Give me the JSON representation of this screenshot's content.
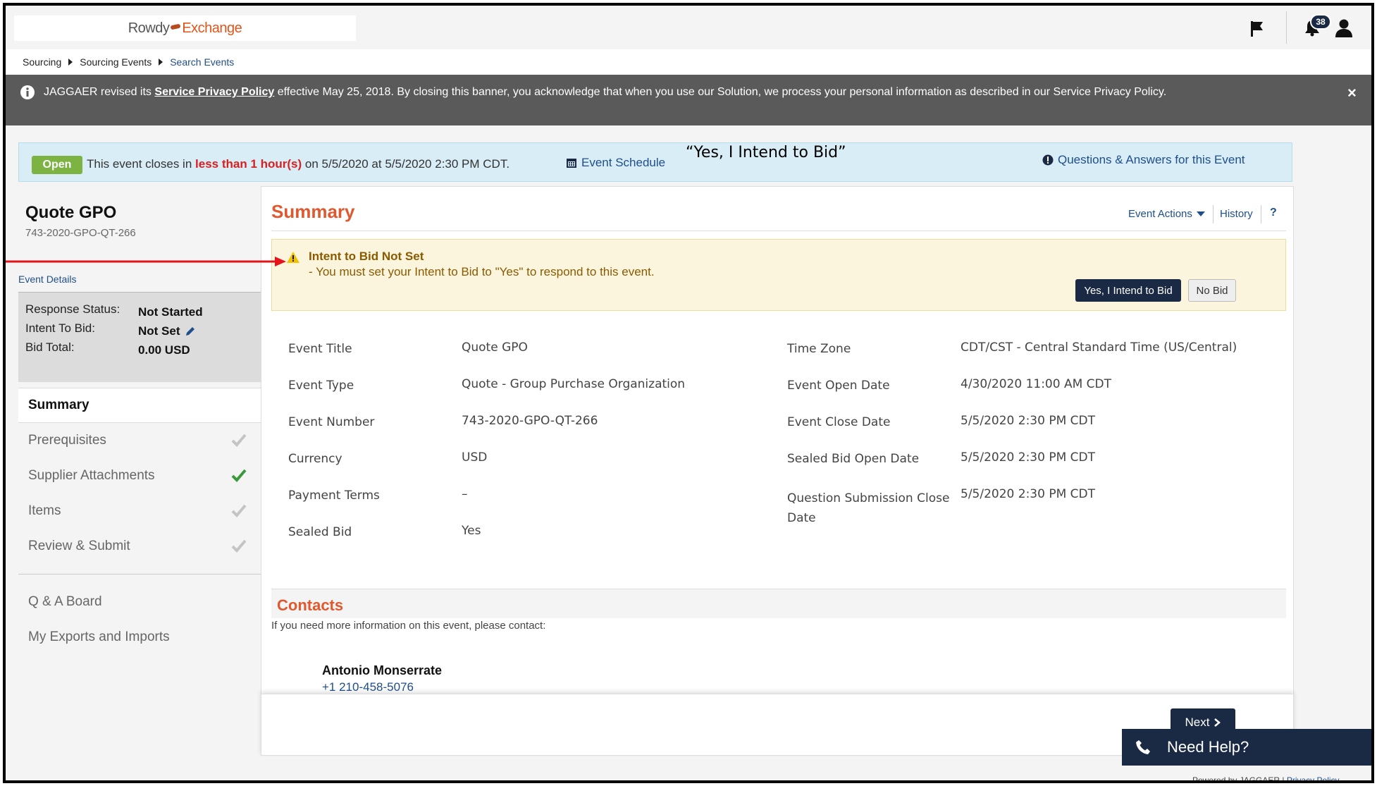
{
  "header": {
    "logo_part1": "Rowdy",
    "logo_part2": "Exchange",
    "notification_count": "38"
  },
  "breadcrumb": [
    "Sourcing",
    "Sourcing Events",
    "Search Events"
  ],
  "privacy_banner": {
    "text_before": "JAGGAER revised its",
    "link": "Service Privacy Policy",
    "text_after": "effective May 25, 2018. By closing this banner, you acknowledge that when you use our Solution, we process your personal information as described in our Service Privacy Policy.",
    "close": "×"
  },
  "status": {
    "badge": "Open",
    "text_before": "This event closes in",
    "red_text": "less than 1 hour(s)",
    "text_after": "on 5/5/2020 at 5/5/2020 2:30 PM CDT.",
    "schedule_link": "Event Schedule",
    "qa_link": "Questions & Answers for this Event"
  },
  "annotation": "“Yes, I Intend to Bid”",
  "sidebar": {
    "event_title": "Quote GPO",
    "event_number": "743-2020-GPO-QT-266",
    "event_details_link": "Event Details",
    "response_status_label": "Response Status:",
    "response_status_value": "Not Started",
    "intent_label": "Intent To Bid:",
    "intent_value": "Not Set",
    "bid_total_label": "Bid Total:",
    "bid_total_value": "0.00 USD",
    "nav": [
      {
        "label": "Summary"
      },
      {
        "label": "Prerequisites"
      },
      {
        "label": "Supplier Attachments"
      },
      {
        "label": "Items"
      },
      {
        "label": "Review & Submit"
      },
      {
        "label": "Q & A Board"
      },
      {
        "label": "My Exports and Imports"
      }
    ]
  },
  "main": {
    "title": "Summary",
    "event_actions": "Event Actions",
    "history": "History",
    "help": "?",
    "warning_title": "Intent to Bid Not Set",
    "warning_text": "- You must set your Intent to Bid to \"Yes\" to respond to this event.",
    "btn_yes": "Yes, I Intend to Bid",
    "btn_no": "No Bid",
    "fields_left": [
      {
        "label": "Event Title",
        "value": "Quote GPO"
      },
      {
        "label": "Event Type",
        "value": "Quote - Group Purchase Organization"
      },
      {
        "label": "Event Number",
        "value": "743-2020-GPO-QT-266"
      },
      {
        "label": "Currency",
        "value": "USD"
      },
      {
        "label": "Payment Terms",
        "value": "–"
      },
      {
        "label": "Sealed Bid",
        "value": "Yes"
      }
    ],
    "fields_right": [
      {
        "label": "Time Zone",
        "value": "CDT/CST - Central Standard Time (US/Central)"
      },
      {
        "label": "Event Open Date",
        "value": "4/30/2020 11:00 AM CDT"
      },
      {
        "label": "Event Close Date",
        "value": "5/5/2020 2:30 PM CDT"
      },
      {
        "label": "Sealed Bid Open Date",
        "value": "5/5/2020 2:30 PM CDT"
      },
      {
        "label": "Question Submission Close Date",
        "value": "5/5/2020 2:30 PM CDT"
      }
    ],
    "contacts_title": "Contacts",
    "contacts_text": "If you need more information on this event, please contact:",
    "contact_name": "Antonio Monserrate",
    "contact_phone": "+1 210-458-5076",
    "next": "Next"
  },
  "help": {
    "label": "Need Help?"
  },
  "footer": {
    "powered": "Powered by JAGGAER |",
    "privacy": "Privacy Policy"
  },
  "colors": {
    "navy": "#1b2a44",
    "accent_orange": "#e0582e",
    "open_green": "#7cb342",
    "alert_red": "#d91f1f",
    "link_blue": "#1f4e8c"
  }
}
